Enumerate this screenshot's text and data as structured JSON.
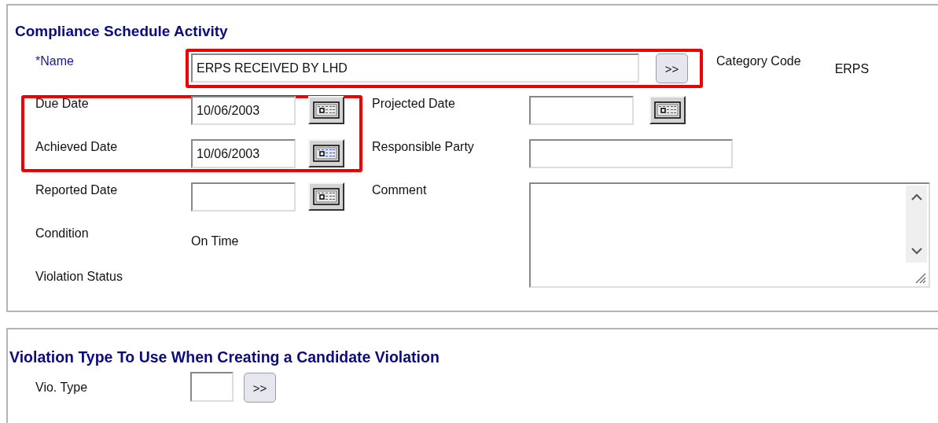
{
  "activity_section": {
    "title": "Compliance Schedule Activity",
    "name_field": {
      "label": "*Name",
      "required": true,
      "highlighted": true,
      "value": "ERPS RECEIVED BY LHD",
      "button": ">>"
    },
    "category_code": {
      "label": "Category Code",
      "value": "ERPS"
    },
    "rows": [
      {
        "label": "Due Date",
        "kind": "date",
        "highlighted": true,
        "value": "10/06/2003",
        "right": {
          "label": "Projected Date",
          "kind": "date"
        }
      },
      {
        "label": "Achieved Date",
        "kind": "date",
        "highlighted": true,
        "value": "10/06/2003",
        "right": {
          "label": "Responsible Party",
          "kind": "text"
        }
      },
      {
        "label": "Reported Date",
        "kind": "date",
        "highlighted": false,
        "right": {
          "label": "Comment",
          "kind": "textarea"
        }
      },
      {
        "label": "Condition",
        "kind": "static",
        "highlighted": false,
        "value": "On Time"
      },
      {
        "label": "Violation Status",
        "kind": "static",
        "highlighted": false
      }
    ]
  },
  "violation_section": {
    "title": "Violation Type To Use When Creating a Candidate Violation",
    "vio_type": {
      "label": "Vio. Type",
      "button": ">>"
    }
  }
}
